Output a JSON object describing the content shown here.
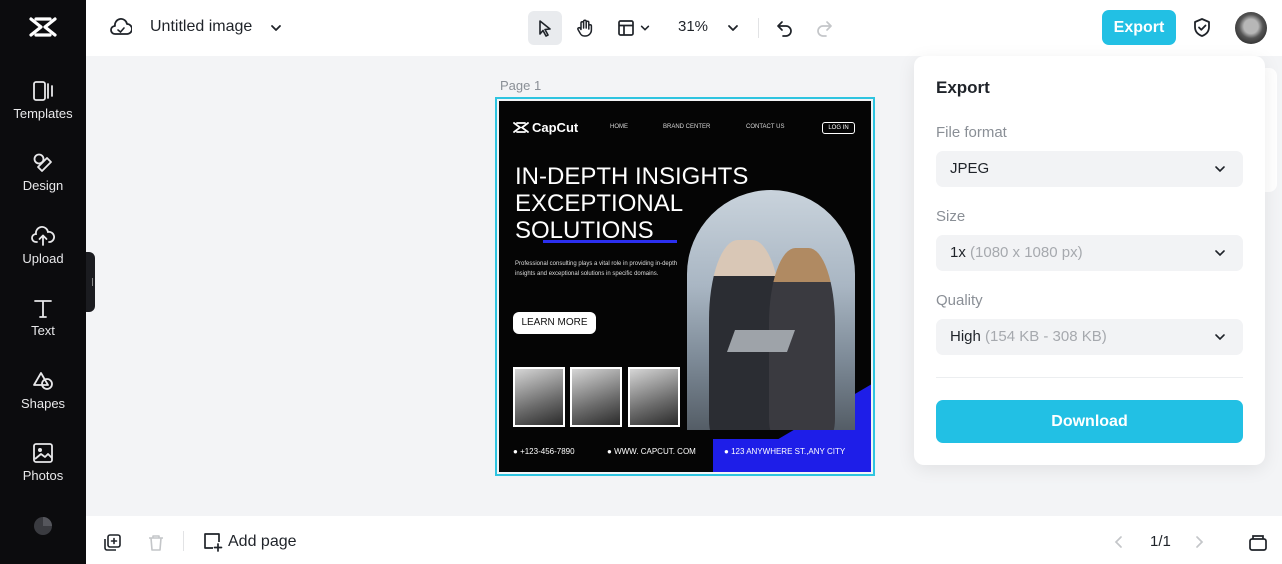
{
  "sidebar": {
    "items": [
      {
        "label": "Templates",
        "icon": "templates-icon"
      },
      {
        "label": "Design",
        "icon": "design-icon"
      },
      {
        "label": "Upload",
        "icon": "upload-icon"
      },
      {
        "label": "Text",
        "icon": "text-icon"
      },
      {
        "label": "Shapes",
        "icon": "shapes-icon"
      },
      {
        "label": "Photos",
        "icon": "photos-icon"
      }
    ]
  },
  "header": {
    "title": "Untitled image",
    "zoom": "31%",
    "export_label": "Export"
  },
  "canvas": {
    "page_label": "Page 1",
    "design": {
      "brand": "CapCut",
      "nav": [
        "HOME",
        "BRAND CENTER",
        "CONTACT US"
      ],
      "login": "LOG IN",
      "headline": [
        "IN-DEPTH INSIGHTS",
        "EXCEPTIONAL",
        "SOLUTIONS"
      ],
      "subtext": "Professional consulting plays a vital role in providing in-depth insights and exceptional solutions in specific domains.",
      "cta": "LEARN MORE",
      "phone": "+123-456-7890",
      "website": "WWW. CAPCUT. COM",
      "address": "123 ANYWHERE ST.,ANY CITY"
    }
  },
  "export_panel": {
    "title": "Export",
    "file_format_label": "File format",
    "file_format_value": "JPEG",
    "size_label": "Size",
    "size_value": "1x",
    "size_detail": "(1080 x 1080 px)",
    "quality_label": "Quality",
    "quality_value": "High",
    "quality_detail": "(154 KB - 308 KB)",
    "download_label": "Download"
  },
  "footer": {
    "add_page_label": "Add page",
    "pager": "1/1"
  },
  "colors": {
    "accent": "#22c0e4",
    "rail_bg": "#0c0c0e",
    "design_blue": "#1e1ee8"
  }
}
